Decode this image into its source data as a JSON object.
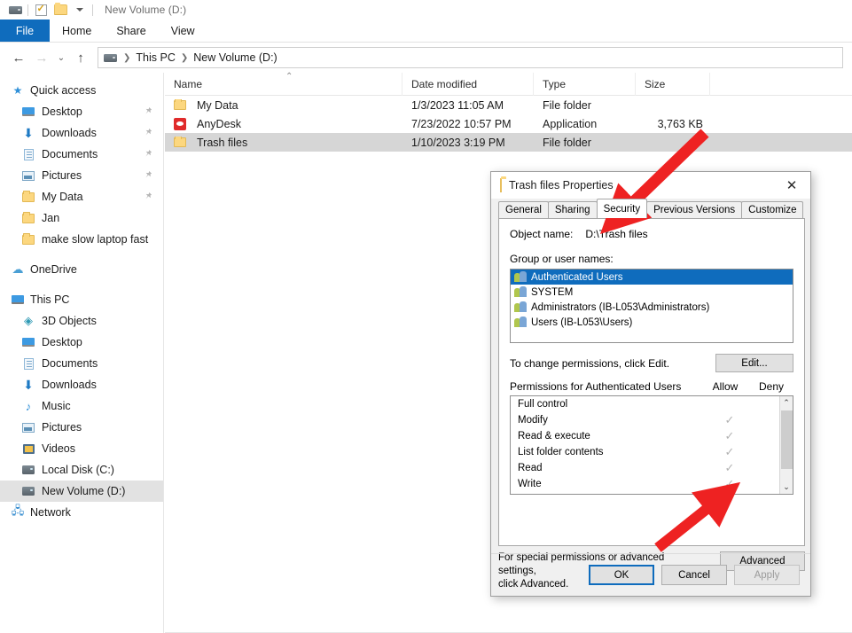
{
  "window": {
    "title": "New Volume (D:)",
    "qat": [
      {
        "name": "drive-icon",
        "icon": "drive"
      },
      {
        "name": "properties-icon",
        "icon": "properties-check"
      },
      {
        "name": "new-folder-icon",
        "icon": "folder"
      },
      {
        "name": "customize-qat-icon",
        "icon": "chevron-down"
      }
    ],
    "ribbon_tabs": [
      {
        "label": "File",
        "active": true
      },
      {
        "label": "Home",
        "active": false
      },
      {
        "label": "Share",
        "active": false
      },
      {
        "label": "View",
        "active": false
      }
    ],
    "nav_buttons": {
      "back": "←",
      "forward": "→",
      "recent": "⌄",
      "up": "↑"
    },
    "breadcrumb": [
      "This PC",
      "New Volume (D:)"
    ]
  },
  "sidebar": {
    "items": [
      {
        "label": "Quick access",
        "icon": "star-icon",
        "level": 0,
        "pinned": false,
        "selected": false
      },
      {
        "label": "Desktop",
        "icon": "monitor-icon",
        "level": 1,
        "pinned": true,
        "selected": false
      },
      {
        "label": "Downloads",
        "icon": "download-icon",
        "level": 1,
        "pinned": true,
        "selected": false
      },
      {
        "label": "Documents",
        "icon": "document-icon",
        "level": 1,
        "pinned": true,
        "selected": false
      },
      {
        "label": "Pictures",
        "icon": "pictures-icon",
        "level": 1,
        "pinned": true,
        "selected": false
      },
      {
        "label": "My Data",
        "icon": "folder-icon",
        "level": 1,
        "pinned": true,
        "selected": false
      },
      {
        "label": "Jan",
        "icon": "folder-icon",
        "level": 1,
        "pinned": false,
        "selected": false
      },
      {
        "label": "make slow laptop fast",
        "icon": "folder-icon",
        "level": 1,
        "pinned": false,
        "selected": false
      },
      {
        "label": "__GAP__",
        "icon": "",
        "level": 0,
        "pinned": false,
        "selected": false
      },
      {
        "label": "OneDrive",
        "icon": "cloud-icon",
        "level": 0,
        "pinned": false,
        "selected": false
      },
      {
        "label": "__GAP__",
        "icon": "",
        "level": 0,
        "pinned": false,
        "selected": false
      },
      {
        "label": "This PC",
        "icon": "pc-icon",
        "level": 0,
        "pinned": false,
        "selected": false
      },
      {
        "label": "3D Objects",
        "icon": "3d-objects-icon",
        "level": 1,
        "pinned": false,
        "selected": false
      },
      {
        "label": "Desktop",
        "icon": "monitor-icon",
        "level": 1,
        "pinned": false,
        "selected": false
      },
      {
        "label": "Documents",
        "icon": "document-icon",
        "level": 1,
        "pinned": false,
        "selected": false
      },
      {
        "label": "Downloads",
        "icon": "download-icon",
        "level": 1,
        "pinned": false,
        "selected": false
      },
      {
        "label": "Music",
        "icon": "music-icon",
        "level": 1,
        "pinned": false,
        "selected": false
      },
      {
        "label": "Pictures",
        "icon": "pictures-icon",
        "level": 1,
        "pinned": false,
        "selected": false
      },
      {
        "label": "Videos",
        "icon": "videos-icon",
        "level": 1,
        "pinned": false,
        "selected": false
      },
      {
        "label": "Local Disk (C:)",
        "icon": "disk-icon",
        "level": 1,
        "pinned": false,
        "selected": false
      },
      {
        "label": "New Volume (D:)",
        "icon": "disk-icon",
        "level": 1,
        "pinned": false,
        "selected": true
      },
      {
        "label": "Network",
        "icon": "network-icon",
        "level": 0,
        "pinned": false,
        "selected": false
      }
    ]
  },
  "filelist": {
    "columns": [
      "Name",
      "Date modified",
      "Type",
      "Size"
    ],
    "sort_column": "Name",
    "sort_direction": "ascending",
    "rows": [
      {
        "name": "My Data",
        "icon": "folder-icon",
        "date": "1/3/2023 11:05 AM",
        "type": "File folder",
        "size": "",
        "selected": false
      },
      {
        "name": "AnyDesk",
        "icon": "anydesk-icon",
        "date": "7/23/2022 10:57 PM",
        "type": "Application",
        "size": "3,763 KB",
        "selected": false
      },
      {
        "name": "Trash files",
        "icon": "folder-icon",
        "date": "1/10/2023 3:19 PM",
        "type": "File folder",
        "size": "",
        "selected": true
      }
    ]
  },
  "dialog": {
    "title": "Trash files Properties",
    "close_label": "✕",
    "tabs": [
      {
        "label": "General",
        "active": false
      },
      {
        "label": "Sharing",
        "active": false
      },
      {
        "label": "Security",
        "active": true
      },
      {
        "label": "Previous Versions",
        "active": false
      },
      {
        "label": "Customize",
        "active": false
      }
    ],
    "object_name_label": "Object name:",
    "object_name_value": "D:\\Trash files",
    "group_label": "Group or user names:",
    "groups": [
      {
        "label": "Authenticated Users",
        "selected": true
      },
      {
        "label": "SYSTEM",
        "selected": false
      },
      {
        "label": "Administrators (IB-L053\\Administrators)",
        "selected": false
      },
      {
        "label": "Users (IB-L053\\Users)",
        "selected": false
      }
    ],
    "change_hint": "To change permissions, click Edit.",
    "edit_label": "Edit...",
    "permissions_title": "Permissions for Authenticated Users",
    "allow_header": "Allow",
    "deny_header": "Deny",
    "permissions": [
      {
        "name": "Full control",
        "allow": false,
        "deny": false
      },
      {
        "name": "Modify",
        "allow": true,
        "deny": false
      },
      {
        "name": "Read & execute",
        "allow": true,
        "deny": false
      },
      {
        "name": "List folder contents",
        "allow": true,
        "deny": false
      },
      {
        "name": "Read",
        "allow": true,
        "deny": false
      },
      {
        "name": "Write",
        "allow": true,
        "deny": false
      }
    ],
    "check_glyph": "✓",
    "advanced_hint_line1": "For special permissions or advanced settings,",
    "advanced_hint_line2": "click Advanced.",
    "advanced_label": "Advanced",
    "buttons": {
      "ok": "OK",
      "cancel": "Cancel",
      "apply": "Apply"
    }
  },
  "annotations": {
    "arrow_color": "#ee2222",
    "arrows": [
      {
        "name": "arrow-to-security-tab",
        "points_to": "Security"
      },
      {
        "name": "arrow-to-advanced-button",
        "points_to": "Advanced"
      }
    ]
  }
}
